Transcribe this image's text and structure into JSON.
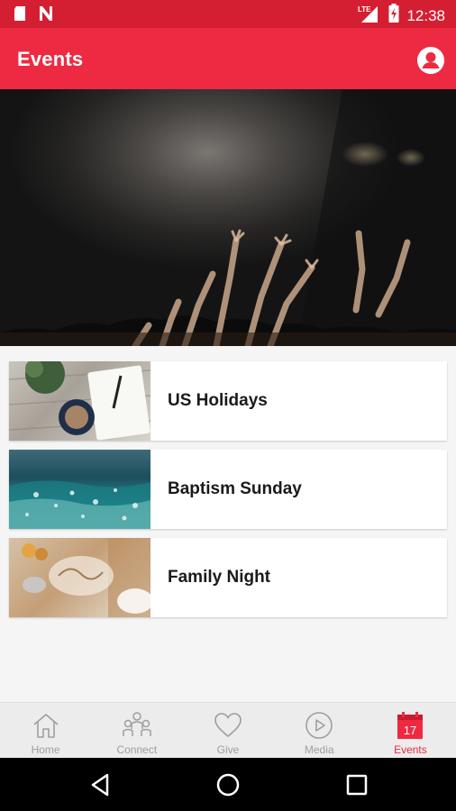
{
  "status_bar": {
    "time": "12:38",
    "network": "LTE",
    "left_icons": [
      "sd-card-icon",
      "n-notification-icon"
    ],
    "right_icons": [
      "signal-icon",
      "battery-charging-icon"
    ]
  },
  "app_bar": {
    "title": "Events",
    "profile_icon": "account-circle-icon"
  },
  "events": [
    {
      "title": "US Holidays",
      "thumbnail": "holidays-thumbnail"
    },
    {
      "title": "Baptism Sunday",
      "thumbnail": "baptism-thumbnail"
    },
    {
      "title": "Family Night",
      "thumbnail": "family-thumbnail"
    }
  ],
  "bottom_nav": {
    "items": [
      {
        "label": "Home",
        "icon": "home-icon",
        "active": false
      },
      {
        "label": "Connect",
        "icon": "people-icon",
        "active": false
      },
      {
        "label": "Give",
        "icon": "heart-icon",
        "active": false
      },
      {
        "label": "Media",
        "icon": "play-circle-icon",
        "active": false
      },
      {
        "label": "Events",
        "icon": "calendar-icon",
        "active": true,
        "day": "17"
      }
    ]
  },
  "colors": {
    "status_bar": "#d41f33",
    "app_bar": "#ee2a42",
    "accent": "#ee2a42",
    "nav_inactive": "#9e9e9e"
  }
}
